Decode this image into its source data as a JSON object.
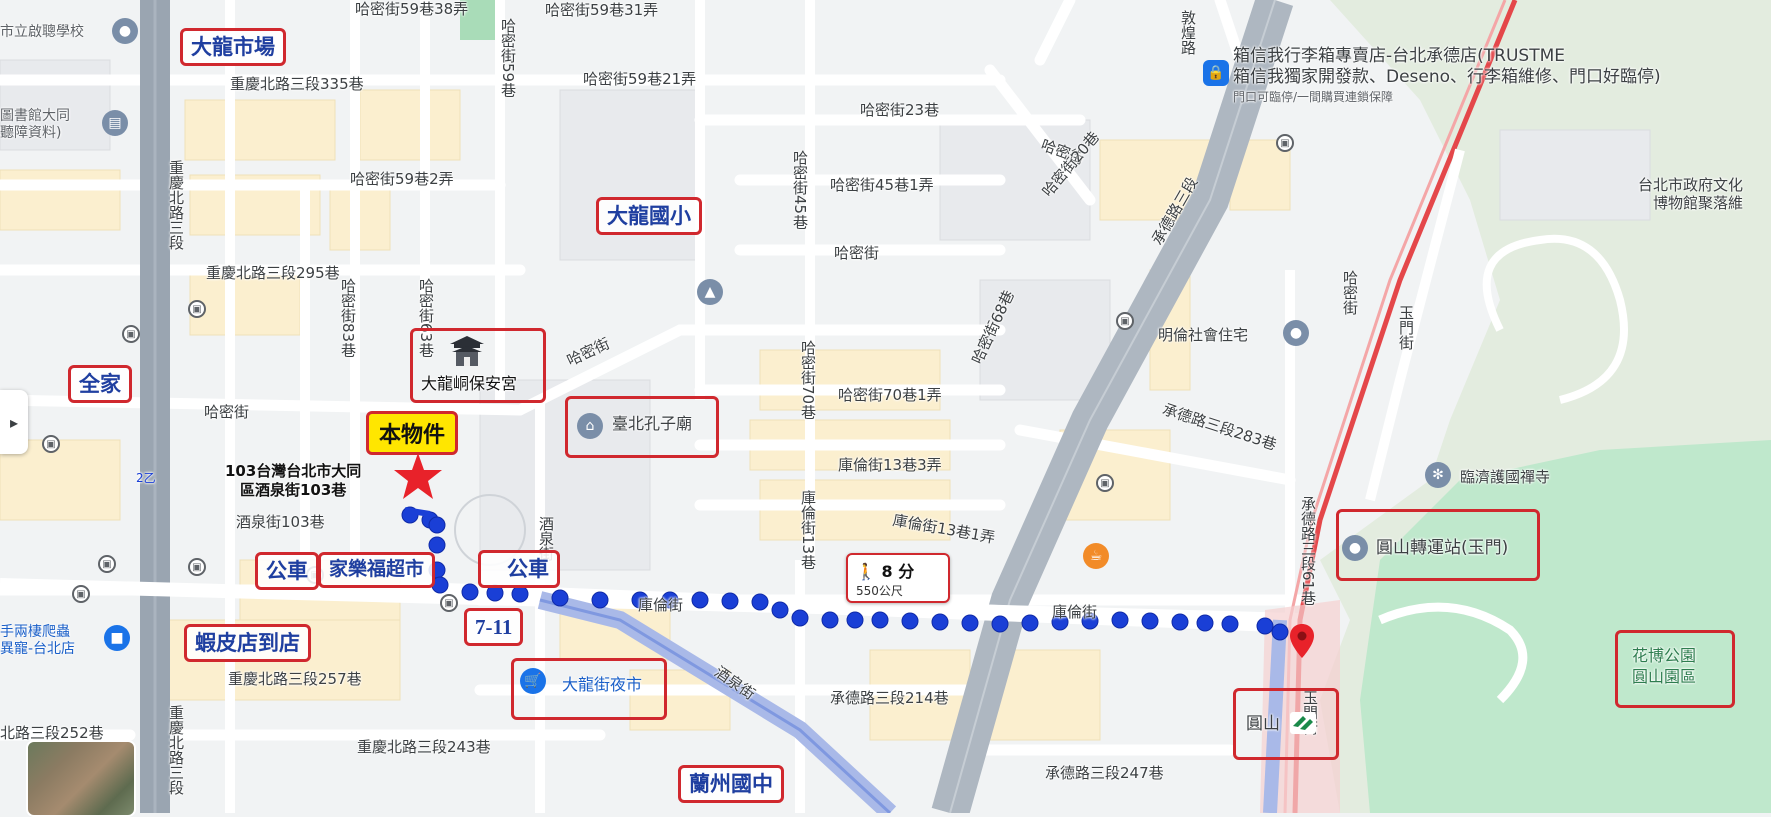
{
  "annotations": {
    "dalong_market": "大龍市場",
    "family_mart": "全家",
    "dalong_primary": "大龍國小",
    "baoan_temple": "大龍峒保安宮",
    "subject": "本物件",
    "bus_1": "公車",
    "carrefour": "家樂福超市",
    "bus_2": "公車",
    "seven_eleven": "7-11",
    "shopee": "蝦皮店到店",
    "confucius": "臺北孔子廟",
    "dalong_night_market": "大龍街夜市",
    "lanzhou_junior": "蘭州國中",
    "yuanshan_transfer": "圓山轉運站(玉門)",
    "yuanshan_station": "圓山",
    "expo_park": "花博公園\n圓山園區"
  },
  "address": {
    "line1": "103台灣台北市大同",
    "line2": "區酒泉街103巷"
  },
  "walk": {
    "time": "8 分",
    "distance": "550公尺"
  },
  "store": {
    "line1": "箱信我行李箱專賣店-台北承德店(TRUSTME",
    "line2": "箱信我獨家開發款、Deseno、行李箱維修、門口好臨停)",
    "line3": "門口可臨停/一間購買連鎖保障"
  },
  "labels": {
    "hami_59_38": "哈密街59巷38弄",
    "hami_59_31": "哈密街59巷31弄",
    "hami_59_21": "哈密街59巷21弄",
    "hami_59v": "哈密街59巷",
    "chongqing_335": "重慶北路三段335巷",
    "hami_23": "哈密街23巷",
    "hami_59_2": "哈密街59巷2弄",
    "hami_45_1": "哈密街45巷1弄",
    "hami_45v": "哈密街45巷",
    "hami_1": "哈密街",
    "hami_20v": "哈密街20巷",
    "chengde_3": "承德路三段",
    "chongqing_295": "重慶北路三段295巷",
    "hami_83v": "哈密街83巷",
    "hami_63v": "哈密街63巷",
    "hami_2": "哈密街",
    "hami_3": "哈密街",
    "minglun": "明倫社會住宅",
    "hami_70_1": "哈密街70巷1弄",
    "hami_70v": "哈密街70巷",
    "hami_68v": "哈密街68巷",
    "hami_4": "哈密街",
    "kulun_13_3": "庫倫街13巷3弄",
    "chengde_283": "承德路三段283巷",
    "kulun_13v": "庫倫街13巷",
    "kulun_13_1": "庫倫街13巷1弄",
    "jiuquan_103": "酒泉街103巷",
    "kulun_1": "庫倫街",
    "kulun_2": "庫倫街",
    "jiuquan": "酒泉街",
    "chengde_214": "承德路三段214巷",
    "chongqing_257": "重慶北路三段257巷",
    "chongqing_243": "重慶北路三段243巷",
    "chongqing_252": "北路三段252巷",
    "chengde_247": "承德路三段247巷",
    "chongqing_v1": "重慶北路三段",
    "chongqing_v2": "重慶北路三段",
    "hami_v_right": "哈密街",
    "yumen_v": "玉門街",
    "yumen_v2": "玉門街",
    "chengde_61v": "承德路三段61巷",
    "linji": "臨濟護國禪寺",
    "museum": "台北市政府文化\n博物館聚落維",
    "dunhuang": "敦煌路",
    "route_2": "2乙",
    "jiuquan_v": "酒泉街",
    "school_top": "市立啟聰學校",
    "library": "圖書館大同\n聽障資料)",
    "pet": "手兩棲爬蟲\n異寵-台北店"
  },
  "colors": {
    "annotation_border": "#d0282e",
    "annotation_text": "#1f3fa0",
    "route": "#1a3fd6",
    "park": "#cdeedb",
    "highway": "#9aa5b1",
    "metro_line": "#e4474a"
  },
  "icons": [
    "location-pin-icon",
    "bus-stop-icon",
    "school-icon",
    "temple-icon",
    "shopping-cart-icon",
    "cafe-icon",
    "walk-icon",
    "metro-icon",
    "luggage-store-icon",
    "chevron-right-icon"
  ]
}
